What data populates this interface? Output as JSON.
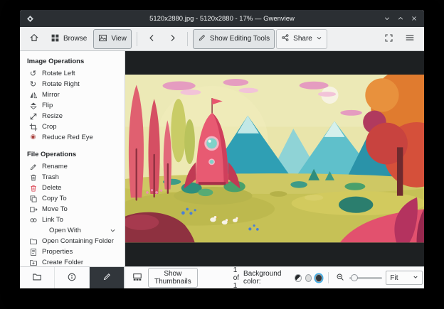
{
  "window": {
    "title": "5120x2880.jpg - 5120x2880 - 17% — Gwenview"
  },
  "toolbar": {
    "browse": "Browse",
    "view": "View",
    "show_editing_tools": "Show Editing Tools",
    "share": "Share"
  },
  "sidebar": {
    "image_operations_header": "Image Operations",
    "image_operations": [
      {
        "label": "Rotate Left",
        "icon": "rotate-left-icon"
      },
      {
        "label": "Rotate Right",
        "icon": "rotate-right-icon"
      },
      {
        "label": "Mirror",
        "icon": "mirror-icon"
      },
      {
        "label": "Flip",
        "icon": "flip-icon"
      },
      {
        "label": "Resize",
        "icon": "resize-icon"
      },
      {
        "label": "Crop",
        "icon": "crop-icon"
      },
      {
        "label": "Reduce Red Eye",
        "icon": "red-eye-icon"
      }
    ],
    "file_operations_header": "File Operations",
    "file_operations": [
      {
        "label": "Rename",
        "icon": "rename-icon"
      },
      {
        "label": "Trash",
        "icon": "trash-icon"
      },
      {
        "label": "Delete",
        "icon": "delete-icon"
      },
      {
        "label": "Copy To",
        "icon": "copy-icon"
      },
      {
        "label": "Move To",
        "icon": "move-icon"
      },
      {
        "label": "Link To",
        "icon": "link-icon"
      },
      {
        "label": "Open With",
        "icon": "chevron-down-icon"
      },
      {
        "label": "Open Containing Folder",
        "icon": "folder-open-icon"
      },
      {
        "label": "Properties",
        "icon": "document-properties-icon"
      },
      {
        "label": "Create Folder",
        "icon": "folder-new-icon"
      }
    ]
  },
  "statusbar": {
    "show_thumbnails": "Show Thumbnails",
    "counter": "1 of 1",
    "background_color_label": "Background color:",
    "zoom_mode": "Fit"
  },
  "icons": {
    "rotate_left": "↺",
    "rotate_right": "↻",
    "red_eye": "◉"
  },
  "colors": {
    "accent": "#3daee9",
    "titlebar_background": "#2b2f33",
    "toolbar_background": "#eff0f1",
    "viewer_background": "#1d2022",
    "delete_red": "#da4453"
  }
}
